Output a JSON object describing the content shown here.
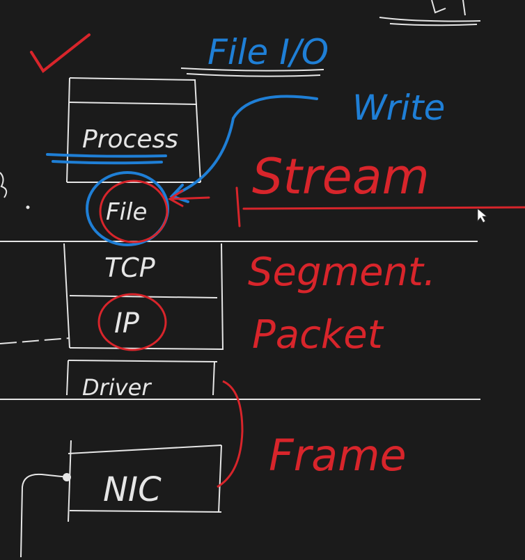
{
  "colors": {
    "background": "#1b1b1b",
    "white_ink": "#e6e6e6",
    "red_ink": "#d8252b",
    "blue_ink": "#1f7fd6",
    "pointer": "#ffffff"
  },
  "labels": {
    "file_io": "File I/O",
    "write": "Write",
    "stream": "Stream",
    "segment": "Segment.",
    "packet": "Packet",
    "frame": "Frame"
  },
  "layers": {
    "process": "Process",
    "file": "File",
    "tcp": "TCP",
    "ip": "IP",
    "driver": "Driver",
    "nic": "NIC"
  },
  "marks": {
    "checkmark_icon": "checkmark-icon",
    "cursor_icon": "cursor-icon"
  }
}
